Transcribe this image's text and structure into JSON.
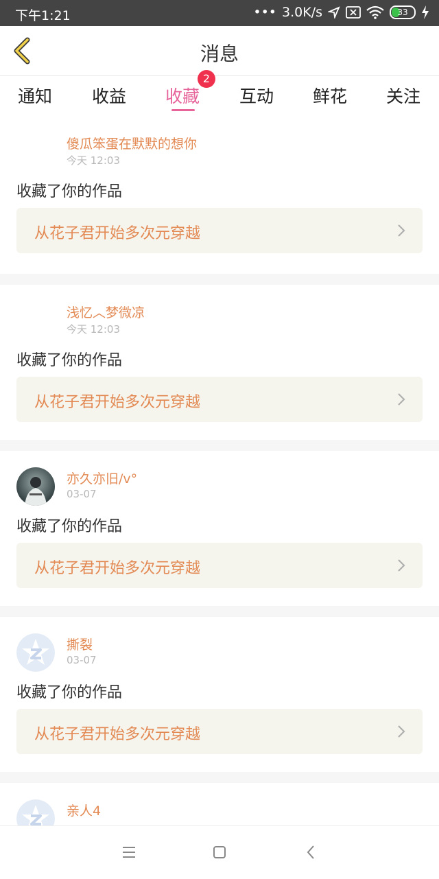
{
  "status_bar": {
    "time": "下午1:21",
    "network_speed": "3.0K/s",
    "battery": "33"
  },
  "header": {
    "title": "消息"
  },
  "tabs": [
    {
      "label": "通知"
    },
    {
      "label": "收益"
    },
    {
      "label": "收藏",
      "active": true,
      "badge": "2"
    },
    {
      "label": "互动"
    },
    {
      "label": "鲜花"
    },
    {
      "label": "关注"
    }
  ],
  "messages": [
    {
      "username": "傻瓜笨蛋在默默的想你",
      "time": "今天 12:03",
      "action": "收藏了你的作品",
      "work": "从花子君开始多次元穿越",
      "avatar": "none"
    },
    {
      "username": "浅忆︿梦微凉",
      "time": "今天 12:03",
      "action": "收藏了你的作品",
      "work": "从花子君开始多次元穿越",
      "avatar": "none"
    },
    {
      "username": "亦久亦旧/v°",
      "time": "03-07",
      "action": "收藏了你的作品",
      "work": "从花子君开始多次元穿越",
      "avatar": "photo"
    },
    {
      "username": "撕裂",
      "time": "03-07",
      "action": "收藏了你的作品",
      "work": "从花子君开始多次元穿越",
      "avatar": "default-z-star"
    },
    {
      "username": "亲人4",
      "time": "",
      "action": "",
      "work": "",
      "avatar": "default-z-star"
    }
  ],
  "colors": {
    "accent": "#e7649b",
    "username": "#e38a54",
    "badge": "#f0314d",
    "link_bg": "#f5f4ed"
  }
}
